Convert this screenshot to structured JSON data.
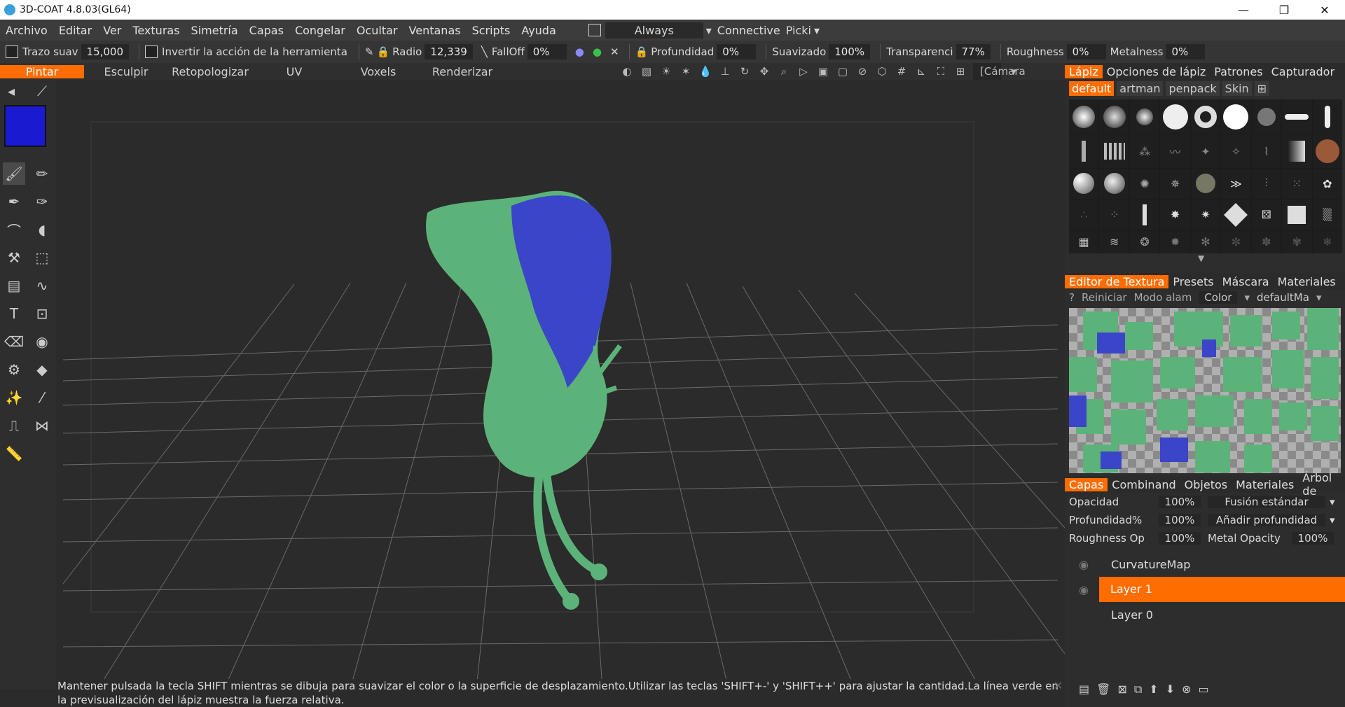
{
  "window": {
    "title": "3D-COAT 4.8.03(GL64)",
    "minimize": "—",
    "restore": "❐",
    "close": "✕"
  },
  "menu": {
    "items": [
      "Archivo",
      "Editar",
      "Ver",
      "Texturas",
      "Simetría",
      "Capas",
      "Congelar",
      "Ocultar",
      "Ventanas",
      "Scripts",
      "Ayuda"
    ],
    "always_label": "Always",
    "connective_label": "Connective",
    "picking_label": "Picki"
  },
  "toolbar": {
    "trazo_label": "Trazo suav",
    "trazo_value": "15,000",
    "invert_label": "Invertir la acción de la herramienta",
    "radio_label": "Radio",
    "radio_value": "12,339",
    "falloff_label": "FallOff",
    "falloff_value": "0%",
    "profundidad_label": "Profundidad",
    "profundidad_value": "0%",
    "suavizado_label": "Suavizado",
    "suavizado_value": "100%",
    "transparencia_label": "Transparenci",
    "transparencia_value": "77%",
    "roughness_label": "Roughness",
    "roughness_value": "0%",
    "metalness_label": "Metalness",
    "metalness_value": "0%"
  },
  "room_tabs": [
    "Pintar",
    "Esculpir",
    "Retopologizar",
    "UV",
    "Voxels",
    "Renderizar"
  ],
  "viewport": {
    "camera": "[Cámara ...]"
  },
  "status": {
    "text": "Mantener pulsada la tecla SHIFT mientras se dibuja para suavizar el color o la superficie de desplazamiento.Utilizar las teclas 'SHIFT+-' y 'SHIFT++' para ajustar la cantidad.La línea verde en la previsualización del lápiz muestra la fuerza relativa."
  },
  "colors": {
    "accent": "#ff6c00",
    "primary_color": "#1a1ad0",
    "mesh_green": "#5cb37a",
    "mesh_blue": "#3a45c8"
  },
  "brush_panel": {
    "tabs": [
      "Lápiz",
      "Opciones de lápiz",
      "Patrones",
      "Capturador"
    ],
    "chips": [
      "default",
      "artman",
      "penpack",
      "Skin"
    ]
  },
  "texture_editor": {
    "tabs": [
      "Editor de Textura",
      "Presets",
      "Máscara",
      "Materiales"
    ],
    "help": "?",
    "reset": "Reiniciar",
    "mode": "Modo alam",
    "channel": "Color",
    "material": "defaultMa"
  },
  "layers_panel": {
    "tabs": [
      "Capas",
      "Combinand",
      "Objetos",
      "Materiales",
      "Árbol de"
    ],
    "opacidad_label": "Opacidad",
    "opacidad_value": "100%",
    "blend_mode": "Fusión estándar",
    "profundidad_label": "Profundidad%",
    "profundidad_value": "100%",
    "depth_mode": "Añadir profundidad",
    "roughness_label": "Roughness Op",
    "roughness_value": "100%",
    "metal_label": "Metal Opacity",
    "metal_value": "100%",
    "layers": [
      "CurvatureMap",
      "Layer 1",
      "Layer 0"
    ]
  }
}
